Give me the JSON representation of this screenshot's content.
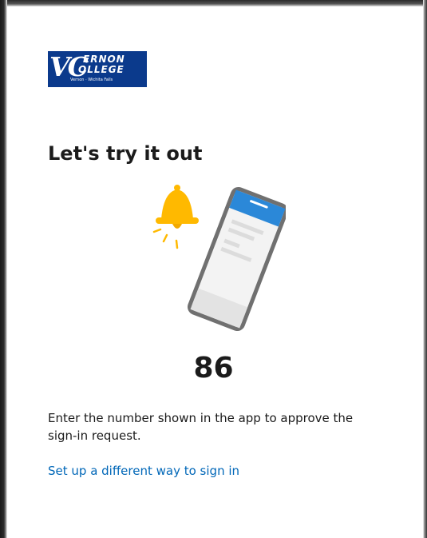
{
  "logo": {
    "mark": "VC",
    "line1": "ERNON",
    "line2": "OLLEGE",
    "tagline": "Vernon · Wichita Falls"
  },
  "page": {
    "title": "Let's try it out",
    "number": "86",
    "description": "Enter the number shown in the app to approve the sign-in request.",
    "alt_method_link": "Set up a different way to sign in"
  },
  "colors": {
    "brand_blue": "#0b3a8c",
    "link_blue": "#0067b8",
    "phone_accent": "#2b88d8",
    "bell_yellow": "#ffb900"
  },
  "icons": {
    "bell": "bell-icon",
    "phone": "phone-icon"
  }
}
